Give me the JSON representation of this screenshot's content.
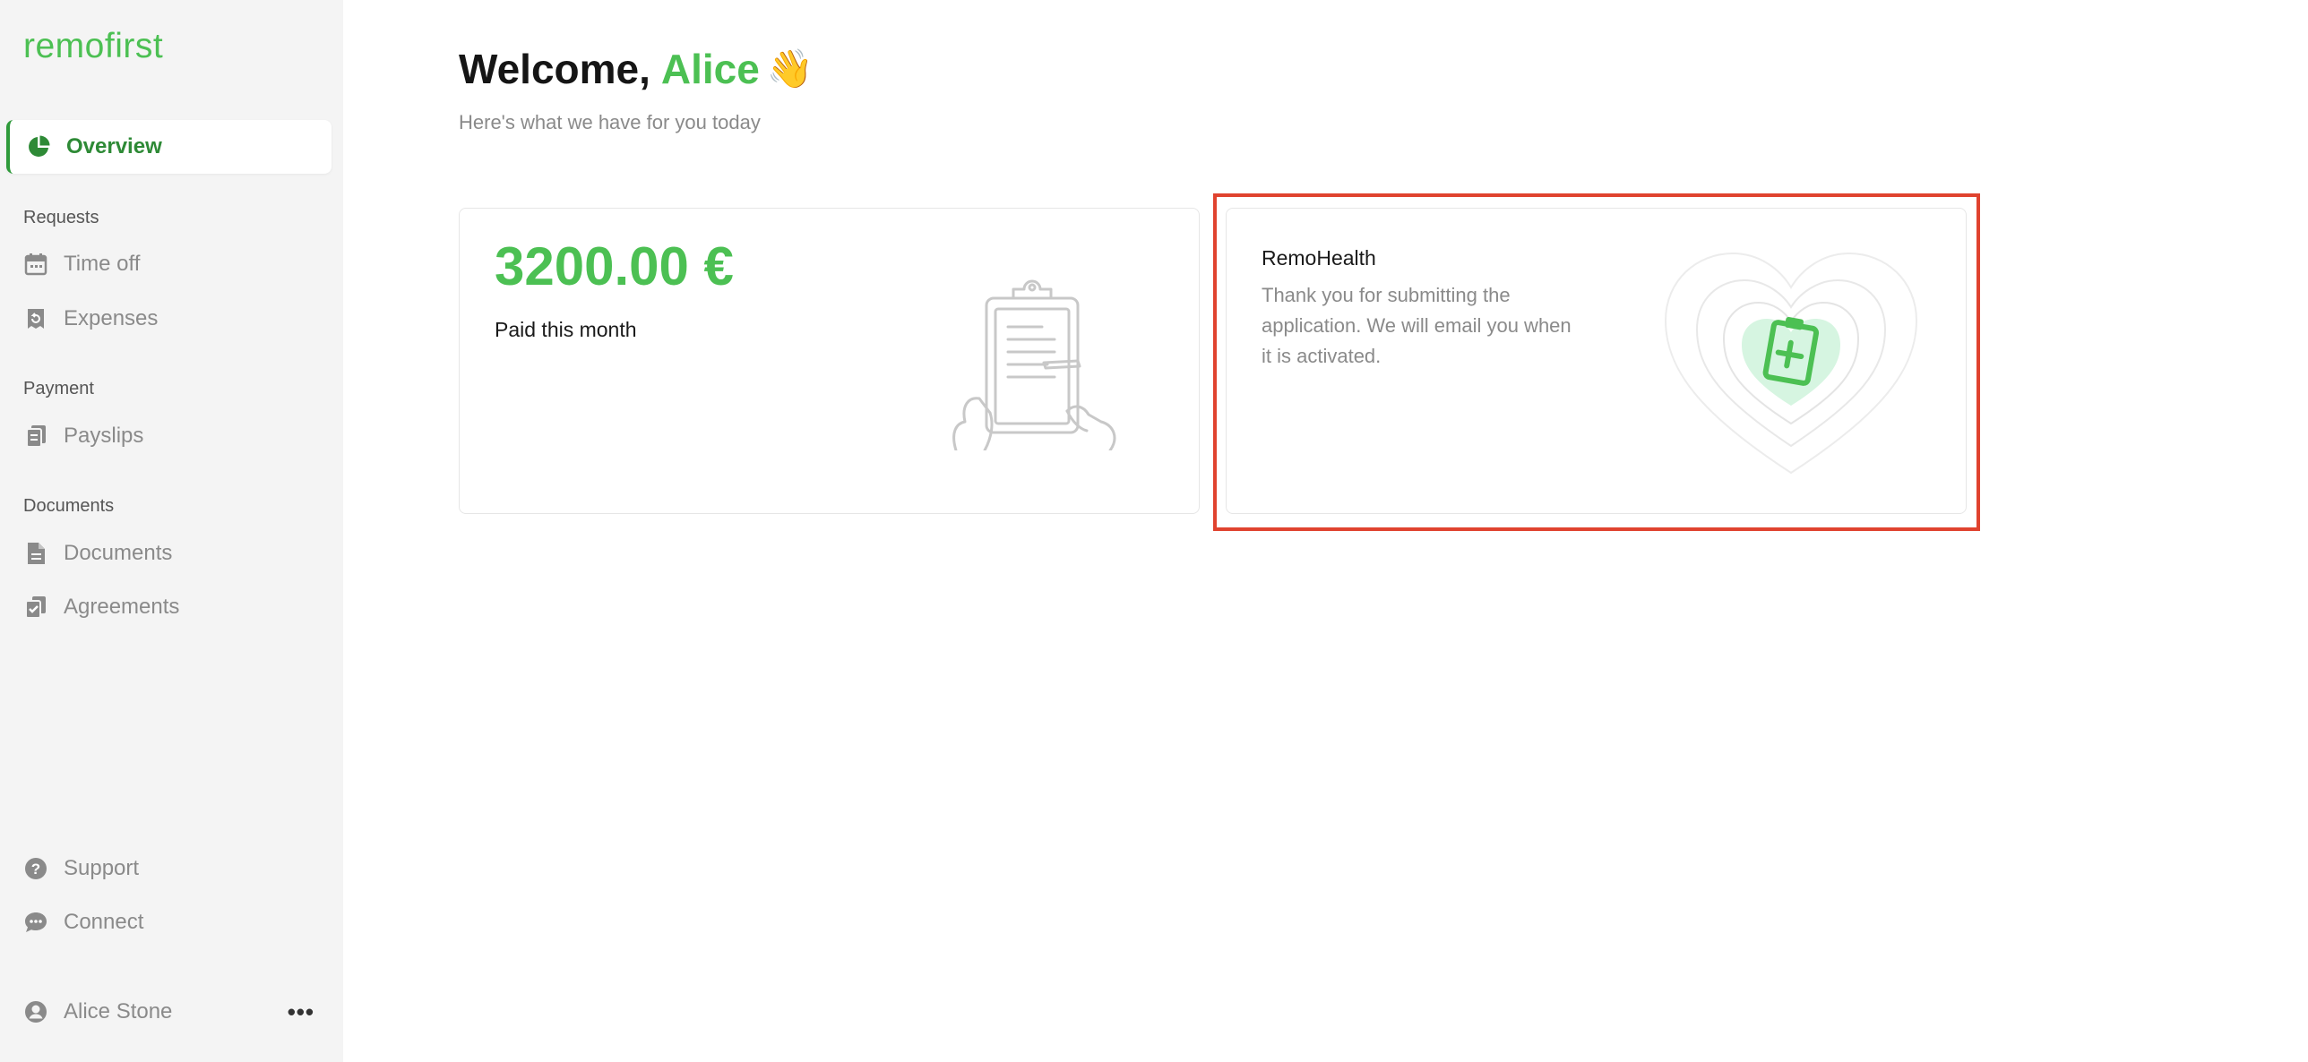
{
  "sidebar": {
    "logo": "remofirst",
    "active_item": {
      "label": "Overview",
      "icon": "pie-chart-icon"
    },
    "sections": [
      {
        "label": "Requests",
        "items": [
          {
            "label": "Time off",
            "icon": "calendar-icon"
          },
          {
            "label": "Expenses",
            "icon": "receipt-icon"
          }
        ]
      },
      {
        "label": "Payment",
        "items": [
          {
            "label": "Payslips",
            "icon": "payslips-icon"
          }
        ]
      },
      {
        "label": "Documents",
        "items": [
          {
            "label": "Documents",
            "icon": "document-icon"
          },
          {
            "label": "Agreements",
            "icon": "agreement-icon"
          }
        ]
      }
    ],
    "footer_items": [
      {
        "label": "Support",
        "icon": "help-icon"
      },
      {
        "label": "Connect",
        "icon": "chat-icon"
      }
    ],
    "user": {
      "name": "Alice Stone",
      "icon": "user-avatar-icon",
      "more": "•••"
    }
  },
  "main": {
    "welcome_prefix": "Welcome,",
    "welcome_name": "Alice",
    "welcome_emoji": "👋",
    "subtitle": "Here's what we have for you today",
    "payment_card": {
      "amount": "3200.00 €",
      "label": "Paid this month"
    },
    "health_card": {
      "title": "RemoHealth",
      "text": "Thank you for submitting the application. We will email you when it is activated."
    }
  },
  "colors": {
    "accent": "#4cc053",
    "active_text": "#2e8a36",
    "highlight": "#e0432f",
    "sidebar_bg": "#f4f4f4"
  }
}
